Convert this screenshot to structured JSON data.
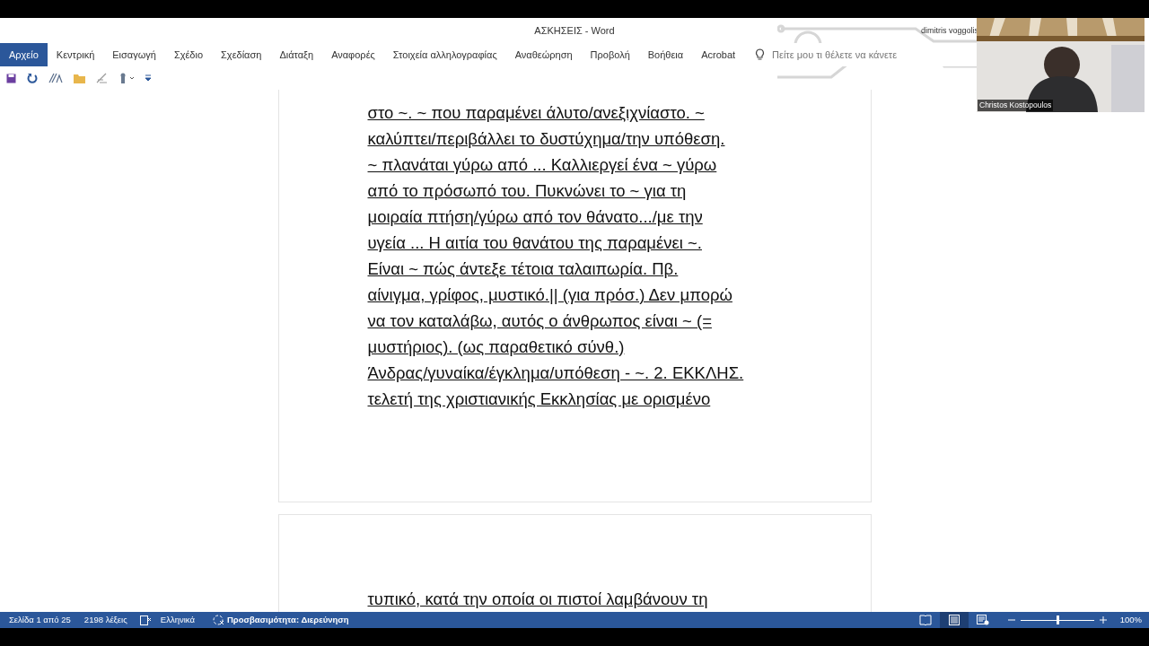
{
  "window": {
    "title": "ΑΣΚΗΣΕΙΣ  -  Word",
    "user": "dimitris voggolis"
  },
  "ribbon_tabs": [
    {
      "label": "Αρχείο",
      "selected": true
    },
    {
      "label": "Κεντρική",
      "selected": false
    },
    {
      "label": "Εισαγωγή",
      "selected": false
    },
    {
      "label": "Σχέδιο",
      "selected": false
    },
    {
      "label": "Σχεδίαση",
      "selected": false
    },
    {
      "label": "Διάταξη",
      "selected": false
    },
    {
      "label": "Αναφορές",
      "selected": false
    },
    {
      "label": "Στοιχεία αλληλογραφίας",
      "selected": false
    },
    {
      "label": "Αναθεώρηση",
      "selected": false
    },
    {
      "label": "Προβολή",
      "selected": false
    },
    {
      "label": "Βοήθεια",
      "selected": false
    },
    {
      "label": "Acrobat",
      "selected": false
    }
  ],
  "tell_me": {
    "placeholder": "Πείτε μου τι θέλετε να κάνετε"
  },
  "pages": [
    {
      "lines": [
        "στο ~. ~ που παραμένει άλυτο/ανεξιχνίαστο. ~",
        "καλύπτει/περιβάλλει το δυστύχημα/την υπόθεση.",
        "~ πλανάται γύρω από ... Καλλιεργεί ένα ~ γύρω",
        "από το πρόσωπό του. Πυκνώνει το ~ για τη",
        "μοιραία πτήση/γύρω από τον θάνατο.../με την",
        "υγεία ... Η αιτία του θανάτου της παραμένει ~.",
        "Είναι ~ πώς άντεξε τέτοια ταλαιπωρία. Πβ.",
        "αίνιγμα, γρίφος, μυστικό.|| (για πρόσ.) Δεν μπορώ",
        "να τον καταλάβω, αυτός ο άνθρωπος είναι ~ (=",
        "μυστήριος). (ως παραθετικό σύνθ.)",
        "Άνδρας/γυναίκα/έγκλημα/υπόθεση - ~. 2. ΕΚΚΛΗΣ.",
        "τελετή της χριστιανικής Εκκλησίας με ορισμένο"
      ]
    },
    {
      "lines": [
        "τυπικό, κατά την οποία οι πιστοί λαμβάνουν τη"
      ]
    }
  ],
  "status_bar": {
    "page": "Σελίδα 1 από 25",
    "words": "2198 λέξεις",
    "language": "Ελληνικά",
    "accessibility": "Προσβασιμότητα: Διερεύνηση",
    "views": [
      {
        "kind": "read",
        "selected": false
      },
      {
        "kind": "print",
        "selected": true
      },
      {
        "kind": "web",
        "selected": false
      }
    ],
    "zoom": {
      "level": 0.5,
      "reading": "100%"
    }
  },
  "video": {
    "kind": "picture",
    "name": "Christos Kostopoulos"
  }
}
